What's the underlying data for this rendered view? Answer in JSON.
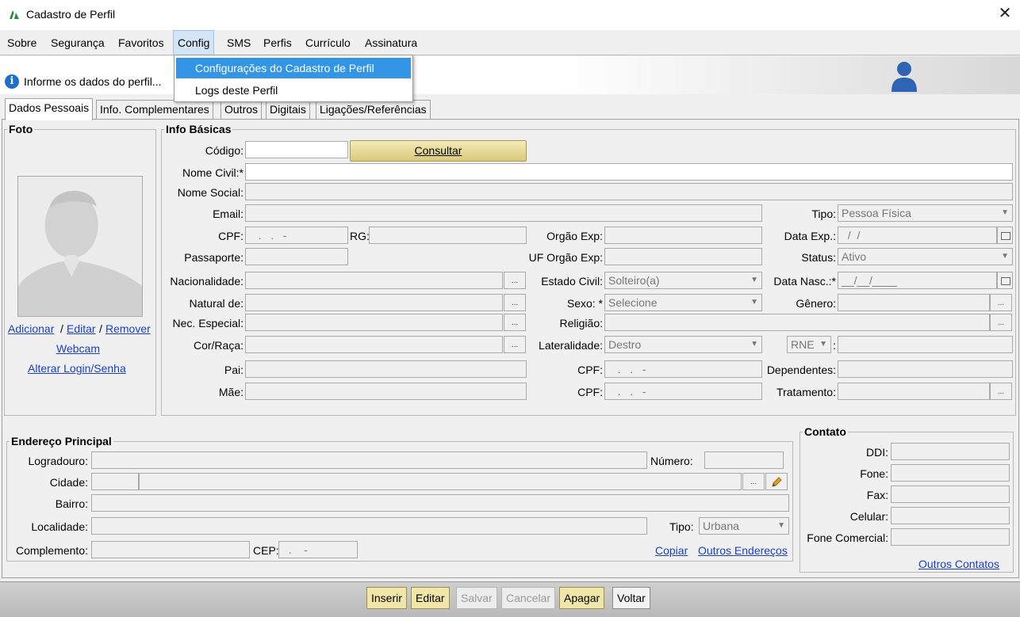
{
  "window": {
    "title": "Cadastro de Perfil"
  },
  "menu": {
    "items": [
      "Sobre",
      "Segurança",
      "Favoritos",
      "Config",
      "SMS",
      "Perfis",
      "Currículo",
      "Assinatura"
    ],
    "active": "Config",
    "dropdown": [
      "Configurações do Cadastro de Perfil",
      "Logs deste Perfil"
    ]
  },
  "info": {
    "text": "Informe os dados do perfil..."
  },
  "tabs": [
    "Dados Pessoais",
    "Info. Complementares",
    "Outros",
    "Digitais",
    "Ligações/Referências"
  ],
  "foto": {
    "title": "Foto",
    "links": {
      "adicionar": "Adicionar",
      "editar": "Editar",
      "remover": "Remover",
      "sep": "/",
      "webcam": "Webcam",
      "alterar": "Alterar Login/Senha"
    }
  },
  "basicas": {
    "title": "Info Básicas",
    "labels": {
      "codigo": "Código:",
      "nome_civil": "Nome Civil:*",
      "nome_social": "Nome Social:",
      "email": "Email:",
      "cpf": "CPF:",
      "rg": "RG:",
      "passaporte": "Passaporte:",
      "nacionalidade": "Nacionalidade:",
      "natural": "Natural de:",
      "nec": "Nec. Especial:",
      "cor": "Cor/Raça:",
      "pai": "Pai:",
      "mae": "Mãe:",
      "orgao": "Orgão Exp:",
      "uf_orgao": "UF Orgão Exp:",
      "estado_civil": "Estado Civil:",
      "sexo": "Sexo: *",
      "religiao": "Religião:",
      "lateralidade": "Lateralidade:",
      "cpf_pai": "CPF:",
      "cpf_mae": "CPF:",
      "tipo": "Tipo:",
      "data_exp": "Data Exp.:",
      "status": "Status:",
      "data_nasc": "Data Nasc.:*",
      "genero": "Gênero:",
      "dependentes": "Dependentes:",
      "tratamento": "Tratamento:",
      "colon": ":"
    },
    "values": {
      "cpf": "   .   .   -",
      "cpf_pai": "   .   .   -",
      "cpf_mae": "   .   .   -",
      "tipo": "Pessoa Física",
      "data_exp": "  /  /",
      "status": "Ativo",
      "data_nasc": "__/__/____",
      "estado_civil": "Solteiro(a)",
      "sexo": "Selecione",
      "lateralidade": "Destro",
      "rne": "RNE"
    },
    "consultar": "Consultar",
    "ellipsis": "..."
  },
  "endereco": {
    "title": "Endereço Principal",
    "labels": {
      "logradouro": "Logradouro:",
      "numero": "Número:",
      "cidade": "Cidade:",
      "bairro": "Bairro:",
      "localidade": "Localidade:",
      "tipo": "Tipo:",
      "complemento": "Complemento:",
      "cep": "CEP:"
    },
    "values": {
      "tipo": "Urbana",
      "cep": "  .    -"
    },
    "copiar": "Copiar",
    "outros": "Outros Endereços"
  },
  "contato": {
    "title": "Contato",
    "labels": {
      "ddi": "DDI:",
      "fone": "Fone:",
      "fax": "Fax:",
      "celular": "Celular:",
      "comercial": "Fone Comercial:"
    },
    "outros": "Outros Contatos"
  },
  "buttons": [
    "Inserir",
    "Editar",
    "Salvar",
    "Cancelar",
    "Apagar",
    "Voltar"
  ]
}
